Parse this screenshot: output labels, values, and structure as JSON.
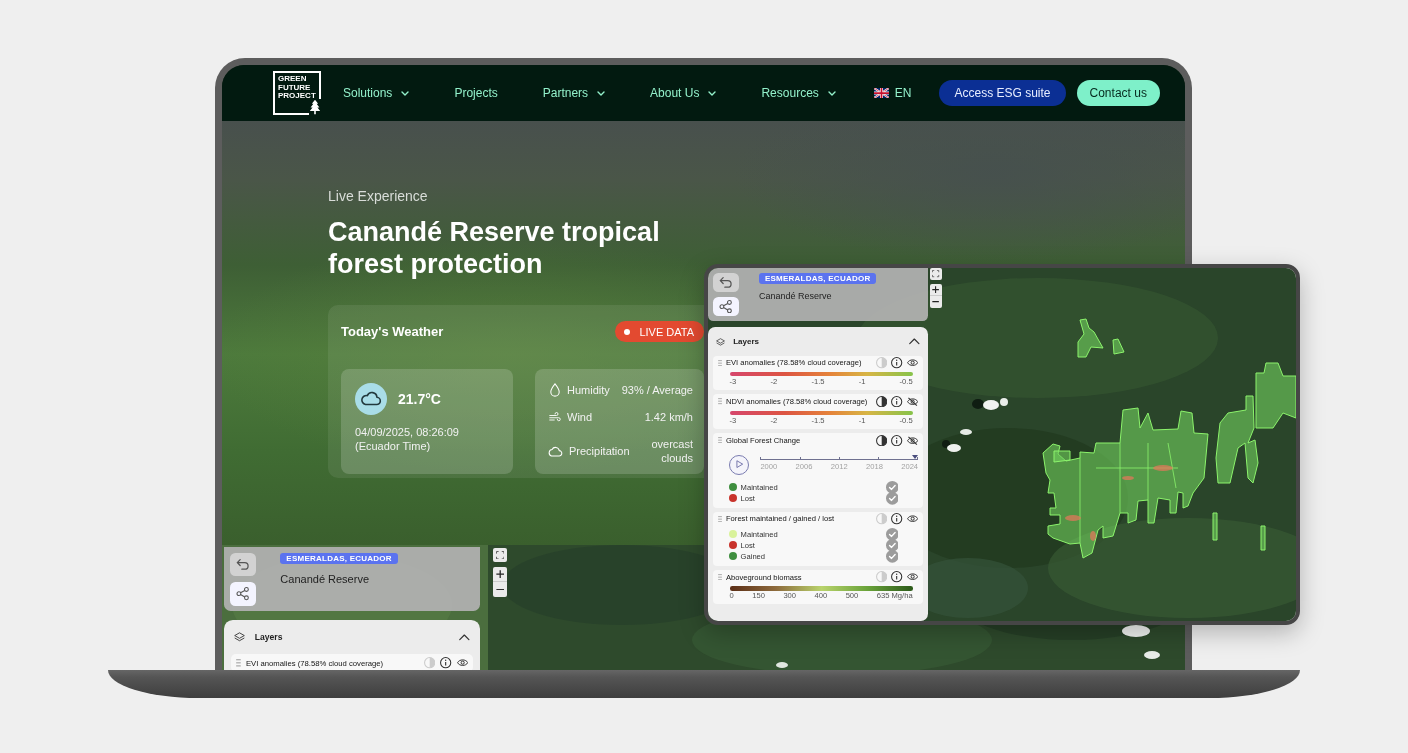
{
  "nav": {
    "logo_text": "GREEN FUTURE PROJECT",
    "items": [
      {
        "label": "Solutions",
        "kind": "dropdown"
      },
      {
        "label": "Projects",
        "kind": "link"
      },
      {
        "label": "Partners",
        "kind": "dropdown"
      },
      {
        "label": "About Us",
        "kind": "dropdown"
      },
      {
        "label": "Resources",
        "kind": "dropdown"
      }
    ],
    "language": "EN",
    "buttons": [
      {
        "label": "Access ESG suite",
        "kind": "primary"
      },
      {
        "label": "Contact us",
        "kind": "accent"
      }
    ]
  },
  "hero": {
    "eyebrow": "Live Experience",
    "title": "Canandé Reserve tropical forest protection"
  },
  "weather": {
    "title": "Today's Weather",
    "badge": "LIVE DATA",
    "temperature": "21.7°C",
    "datetime": "04/09/2025, 08:26:09",
    "timezone": "(Ecuador Time)",
    "details": [
      {
        "kind": "humidity",
        "label": "Humidity",
        "value": "93% / Average"
      },
      {
        "kind": "wind",
        "label": "Wind",
        "value": "1.42 km/h"
      },
      {
        "kind": "precipitation",
        "label": "Precipitation",
        "value": "overcast clouds"
      }
    ]
  },
  "map_widget": {
    "region": "ESMERALDAS, ECUADOR",
    "name": "Canandé Reserve",
    "layers_title": "Layers",
    "expanded": true,
    "layers": [
      {
        "name": "EVI anomalies (78.58% cloud coverage)",
        "contrast_active": false,
        "visible": true
      }
    ]
  },
  "tablet": {
    "region": "ESMERALDAS, ECUADOR",
    "name": "Canandé Reserve",
    "layers_title": "Layers",
    "expanded": true,
    "layers": [
      {
        "kind": "anomaly_scale",
        "name": "EVI anomalies (78.58% cloud coverage)",
        "contrast_active": false,
        "visible": true,
        "ticks": [
          "-3",
          "-2",
          "-1.5",
          "-1",
          "-0.5"
        ]
      },
      {
        "kind": "anomaly_scale",
        "name": "NDVI anomalies (78.58% cloud coverage)",
        "contrast_active": true,
        "visible": false,
        "ticks": [
          "-3",
          "-2",
          "-1.5",
          "-1",
          "-0.5"
        ]
      },
      {
        "kind": "timeline",
        "name": "Global Forest Change",
        "contrast_active": true,
        "visible": false,
        "timeline": {
          "ticks": [
            "2000",
            "2006",
            "2012",
            "2018",
            "2024"
          ],
          "level": 1
        },
        "legend": [
          {
            "label": "Maintained",
            "color": "#3e8e3e",
            "checked": true
          },
          {
            "label": "Lost",
            "color": "#c8332b",
            "checked": true
          }
        ]
      },
      {
        "kind": "legend",
        "name": "Forest maintained / gained / lost",
        "contrast_active": false,
        "visible": true,
        "legend": [
          {
            "label": "Maintained",
            "color": "#d9f29a",
            "checked": true
          },
          {
            "label": "Lost",
            "color": "#c8332b",
            "checked": true
          },
          {
            "label": "Gained",
            "color": "#3e8e3e",
            "checked": true
          }
        ]
      },
      {
        "kind": "biomass_scale",
        "name": "Aboveground biomass",
        "contrast_active": false,
        "visible": true,
        "ticks": [
          "0",
          "150",
          "300",
          "400",
          "500",
          "635 Mg/ha"
        ]
      }
    ]
  }
}
